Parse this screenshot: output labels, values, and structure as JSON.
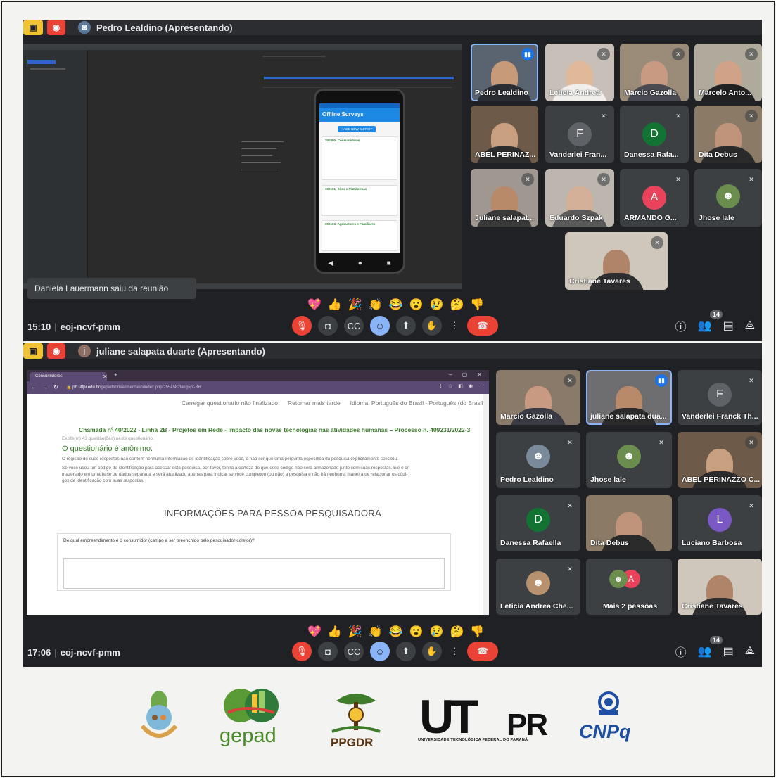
{
  "meeting1": {
    "presenter": "Pedro Lealdino (Apresentando)",
    "toast": "Daniela Lauermann saiu da reunião",
    "time": "15:10",
    "code": "eoj-ncvf-pmm",
    "participant_count": "14",
    "reactions": [
      "💖",
      "👍",
      "🎉",
      "👏",
      "😂",
      "😮",
      "😢",
      "🤔",
      "👎"
    ],
    "app": {
      "title": "Offline Surveys",
      "chip": "+ ADD NEW SURVEY",
      "cards": [
        "300400: Consumidores",
        "400101: Sites e Plataformas",
        "300103: Agricultores e Familiares"
      ]
    },
    "tiles": [
      {
        "name": "Pedro Lealdino",
        "kind": "video"
      },
      {
        "name": "Leticia Andrea",
        "kind": "video"
      },
      {
        "name": "Marcio Gazolla",
        "kind": "video"
      },
      {
        "name": "Marcelo Anto...",
        "kind": "video"
      },
      {
        "name": "ABEL PERINAZ...",
        "kind": "video"
      },
      {
        "name": "Vanderlei Fran...",
        "kind": "avatar",
        "initial": "F"
      },
      {
        "name": "Danessa Rafa...",
        "kind": "avatar",
        "initial": "D"
      },
      {
        "name": "Dita Debus",
        "kind": "video"
      },
      {
        "name": "Juliane salapat...",
        "kind": "video"
      },
      {
        "name": "Eduardo Szpak",
        "kind": "video"
      },
      {
        "name": "ARMANDO G...",
        "kind": "avatar",
        "initial": "A"
      },
      {
        "name": "Jhose lale",
        "kind": "photo"
      },
      {
        "name": "Cristiane Tavares",
        "kind": "video"
      }
    ]
  },
  "meeting2": {
    "presenter": "juliane salapata duarte (Apresentando)",
    "presenter_initial": "j",
    "time": "17:06",
    "code": "eoj-ncvf-pmm",
    "participant_count": "14",
    "reactions": [
      "💖",
      "👍",
      "🎉",
      "👏",
      "😂",
      "😮",
      "😢",
      "🤔",
      "👎"
    ],
    "browser": {
      "tab": "Consumidores",
      "url_host": "pb.utfpr.edu.br",
      "url_path": "/gepadeom/alimentario/index.php/255458?lang=pt-BR",
      "nav_links": [
        "Carregar questionário não finalizado",
        "Retomar mais tarde",
        "Idioma: Português do Brasil - Português (do Brasil) ▾"
      ],
      "call_title": "Chamada nº 40/2022 - Linha 2B - Projetos em Rede - Impacto das novas tecnologias nas atividades humanas – Processo n. 409231/2022-3",
      "count_text": "Existe(m) 43 questão(ões) neste questionário.",
      "anon_title": "O questionário é anônimo.",
      "para1": "O registro de suas respostas não contém nenhuma informação de identificação sobre você, a não ser que uma pergunta específica da pesquisa explicitamente solicitou.",
      "para2a": "Se você usou um código de identificação para acessar esta pesquisa, por favor, tenha a certeza de que esse código não será armazenado junto com suas respostas. Ele é ar-",
      "para2b": "mazenado em uma base de dados separada e será atualizado apenas para indicar se você completou (ou não) a pesquisa e não há nenhuma maneira de relacionar os códi-",
      "para2c": "gos de identificação com suas respostas.",
      "section": "INFORMAÇÕES PARA PESSOA PESQUISADORA",
      "question": "De qual empreendimento é o consumidor (campo a ser preenchido pelo pesquisador-coletor)?"
    },
    "tiles": [
      {
        "name": "Marcio Gazolla",
        "kind": "video"
      },
      {
        "name": "juliane salapata dua...",
        "kind": "video"
      },
      {
        "name": "Vanderlei Franck Th...",
        "kind": "avatar",
        "initial": "F"
      },
      {
        "name": "Pedro Lealdino",
        "kind": "photo"
      },
      {
        "name": "Jhose lale",
        "kind": "photo"
      },
      {
        "name": "ABEL PERINAZZO C...",
        "kind": "video"
      },
      {
        "name": "Danessa Rafaella",
        "kind": "avatar",
        "initial": "D"
      },
      {
        "name": "Dita Debus",
        "kind": "video"
      },
      {
        "name": "Luciano Barbosa",
        "kind": "avatar",
        "initial": "L"
      },
      {
        "name": "Leticia Andrea Che...",
        "kind": "photo"
      },
      {
        "name": "Mais 2 pessoas",
        "kind": "more",
        "initial": "A"
      },
      {
        "name": "Cristiane Tavares",
        "kind": "video"
      }
    ]
  },
  "logos": {
    "gepad": "gepad",
    "ppgdr": "PPGDR",
    "utfpr_ut": "UT",
    "utfpr_pr": "PR",
    "utfpr_sub": "UNIVERSIDADE TECNOLÓGICA FEDERAL DO PARANÁ",
    "cnpq": "CNPq"
  },
  "colors": {
    "meet_bg": "#202124",
    "tile_bg": "#3c4043",
    "hangup": "#ea4335",
    "accent": "#8ab4f8",
    "present_yellow": "#f1c232"
  }
}
